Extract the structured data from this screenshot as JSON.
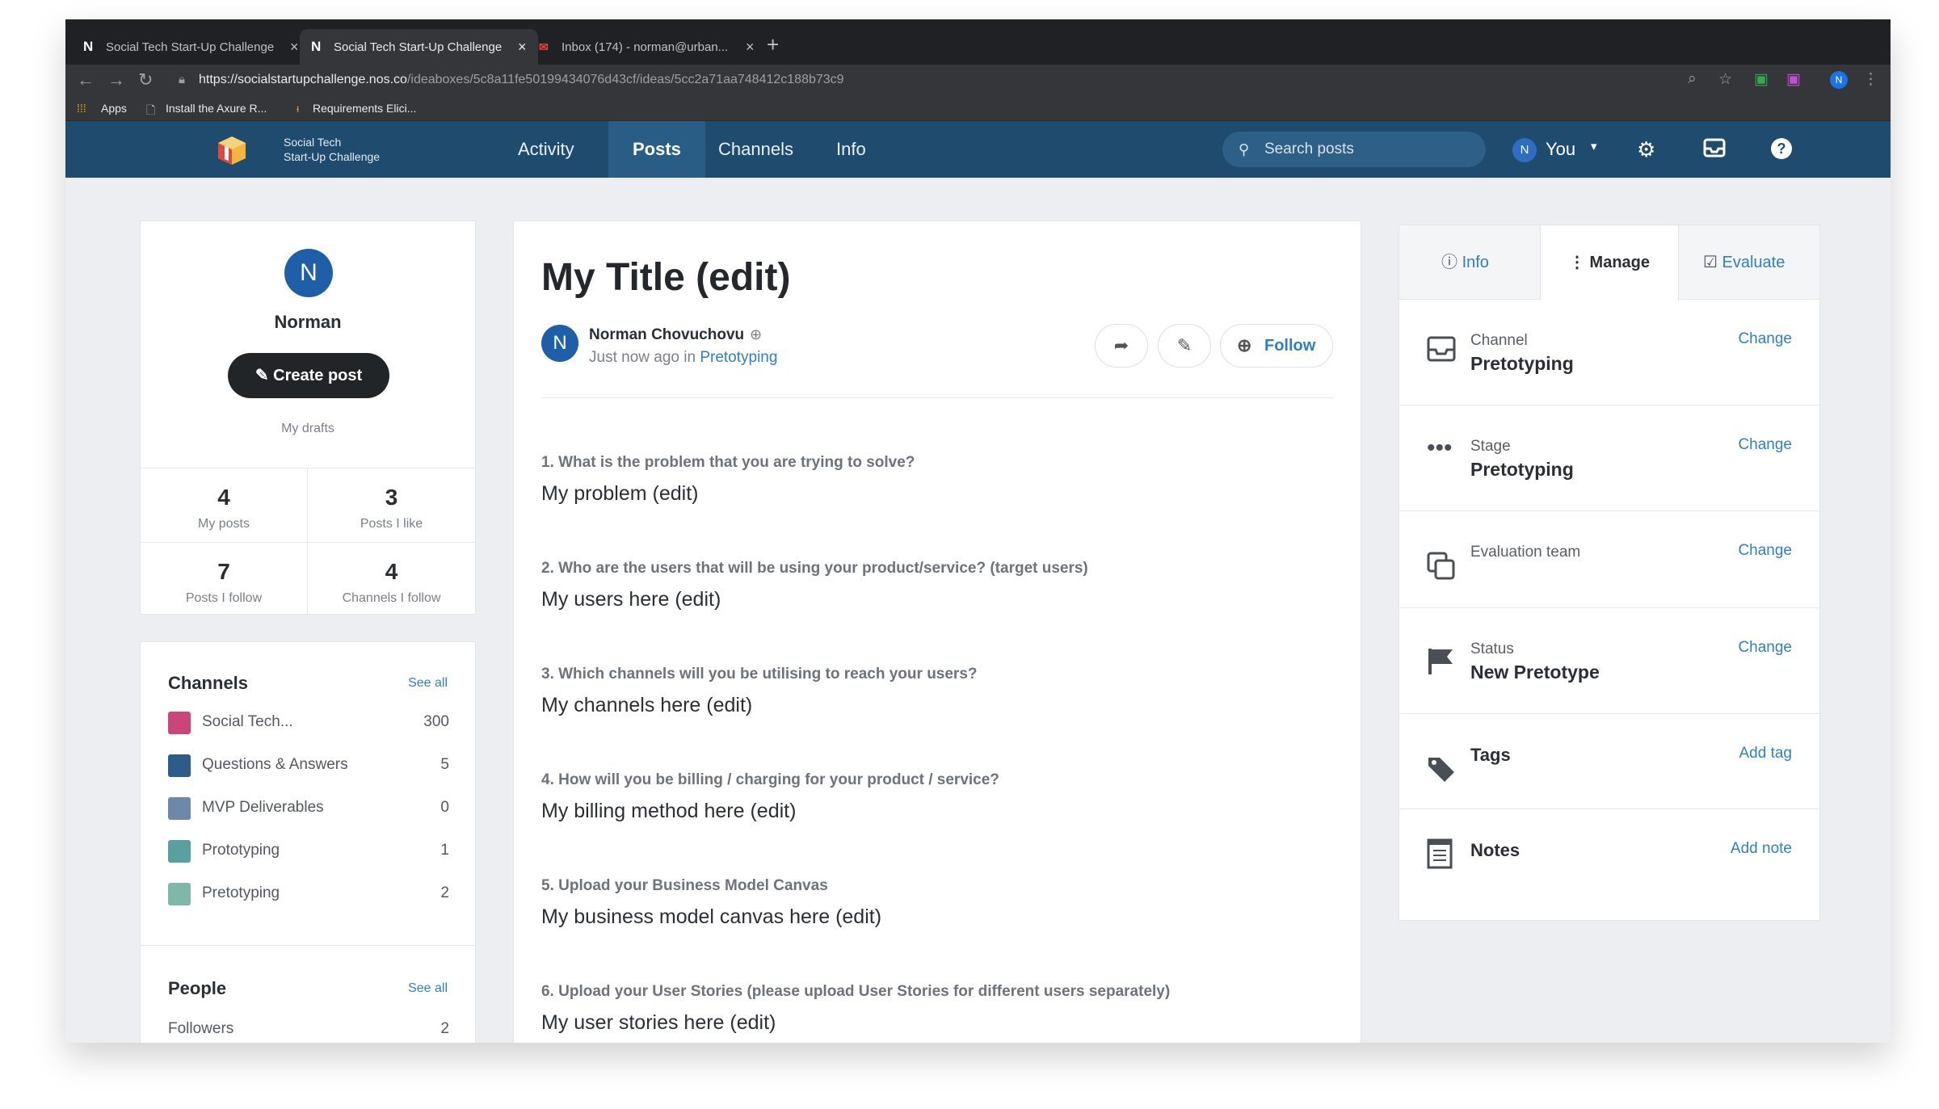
{
  "browser": {
    "tabs": [
      {
        "title": "Social Tech Start-Up Challenge",
        "favicon": "N"
      },
      {
        "title": "Social Tech Start-Up Challenge",
        "favicon": "N"
      },
      {
        "title": "Inbox (174) - norman@urban...",
        "favicon": "M"
      }
    ],
    "url_host": "https://socialstartupchallenge.nos.co",
    "url_path": "/ideaboxes/5c8a11fe50199434076d43cf/ideas/5cc2a71aa748412c188b73c9",
    "bookmarks": [
      "Apps",
      "Install the Axure R...",
      "Requirements Elici..."
    ],
    "profile_initial": "N"
  },
  "app": {
    "logo_line1": "Social Tech",
    "logo_line2": "Start-Up Challenge",
    "nav": [
      "Activity",
      "Posts",
      "Channels",
      "Info"
    ],
    "search_placeholder": "Search posts",
    "user_initial": "N",
    "user_label": "You"
  },
  "profile": {
    "initial": "N",
    "name": "Norman",
    "create_label": "Create post",
    "drafts_label": "My drafts",
    "stats": [
      {
        "num": "4",
        "label": "My posts"
      },
      {
        "num": "3",
        "label": "Posts I like"
      },
      {
        "num": "7",
        "label": "Posts I follow"
      },
      {
        "num": "4",
        "label": "Channels I follow"
      }
    ]
  },
  "channels": {
    "title": "Channels",
    "see_all": "See all",
    "items": [
      {
        "name": "Social Tech...",
        "count": "300",
        "color": "#c9457a"
      },
      {
        "name": "Questions & Answers",
        "count": "5",
        "color": "#2d5c8a"
      },
      {
        "name": "MVP Deliverables",
        "count": "0",
        "color": "#6d88a8"
      },
      {
        "name": "Prototyping",
        "count": "1",
        "color": "#5aa0a0"
      },
      {
        "name": "Pretotyping",
        "count": "2",
        "color": "#7fb8a8"
      }
    ]
  },
  "people": {
    "title": "People",
    "see_all": "See all",
    "followers_label": "Followers",
    "followers_count": "2"
  },
  "post": {
    "title": "My Title (edit)",
    "author_initial": "N",
    "author": "Norman Chovuchovu",
    "time": "Just now ago",
    "in_word": "in",
    "channel": "Pretotyping",
    "follow_label": "Follow",
    "qa": [
      {
        "q": "1. What is the problem that you are trying to solve?",
        "a": "My problem (edit)"
      },
      {
        "q": "2. Who are the users that will be using your product/service? (target users)",
        "a": "My users here (edit)"
      },
      {
        "q": "3. Which channels will you be utilising to reach your users?",
        "a": "My channels here (edit)"
      },
      {
        "q": "4. How will you be billing / charging for your product / service?",
        "a": "My billing method here (edit)"
      },
      {
        "q": "5. Upload your Business Model Canvas",
        "a": "My business model canvas here (edit)"
      },
      {
        "q": "6. Upload your User Stories (please upload User Stories for different users separately)",
        "a": "My user stories here (edit)"
      }
    ]
  },
  "manage": {
    "tabs": [
      "Info",
      "Manage",
      "Evaluate"
    ],
    "rows": [
      {
        "key": "Channel",
        "value": "Pretotyping",
        "action": "Change"
      },
      {
        "key": "Stage",
        "value": "Pretotyping",
        "action": "Change"
      },
      {
        "key": "Evaluation team",
        "value": "",
        "action": "Change"
      },
      {
        "key": "Status",
        "value": "New Pretotype",
        "action": "Change"
      },
      {
        "key": "Tags",
        "value": "",
        "action": "Add tag"
      },
      {
        "key": "Notes",
        "value": "",
        "action": "Add note"
      }
    ]
  }
}
